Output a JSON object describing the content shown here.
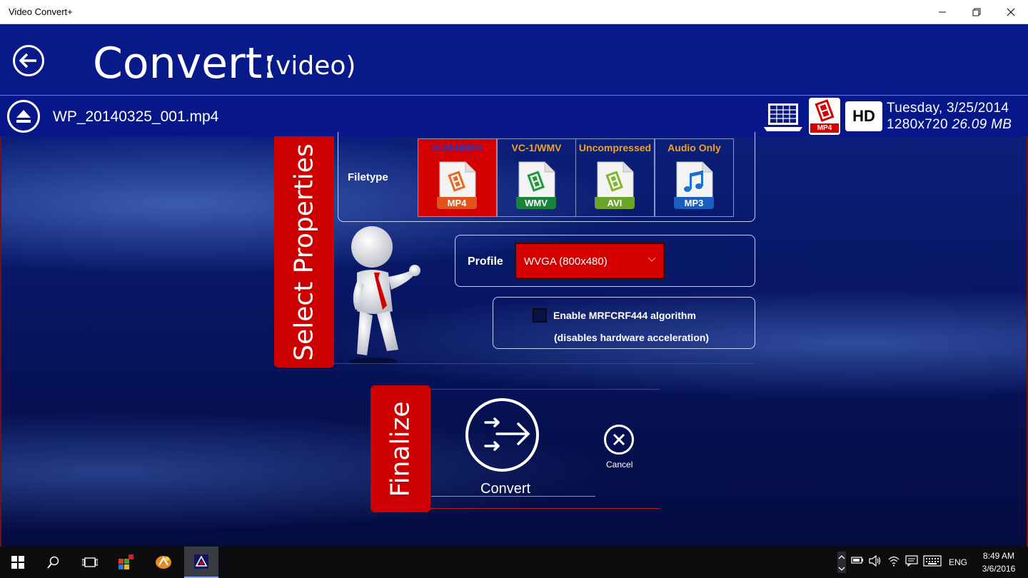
{
  "window": {
    "title": "Video Convert+"
  },
  "header": {
    "title": "Convert:",
    "subtitle": "(video)"
  },
  "file": {
    "name": "WP_20140325_001.mp4",
    "format_badge": "MP4",
    "quality_badge": "HD",
    "date": "Tuesday, 3/25/2014",
    "resolution": "1280x720",
    "size": "26.09 MB"
  },
  "properties": {
    "section_label": "Select Properties",
    "filetype_label": "Filetype",
    "filetypes": [
      {
        "caption": "H.264/MP4",
        "tag": "MP4",
        "selected": true
      },
      {
        "caption": "VC-1/WMV",
        "tag": "WMV",
        "selected": false
      },
      {
        "caption": "Uncompressed",
        "tag": "AVI",
        "selected": false
      },
      {
        "caption": "Audio Only",
        "tag": "MP3",
        "selected": false
      }
    ],
    "profile_label": "Profile",
    "profile_value": "WVGA (800x480)",
    "algorithm_label": "Enable MRFCRF444 algorithm",
    "algorithm_note": "(disables hardware acceleration)",
    "algorithm_checked": false
  },
  "finalize": {
    "section_label": "Finalize",
    "convert_label": "Convert",
    "cancel_label": "Cancel"
  },
  "taskbar": {
    "language": "ENG",
    "time": "8:49 AM",
    "date": "3/6/2016"
  },
  "colors": {
    "accent_red": "#cc0000",
    "header_blue": "#08198a",
    "caption_orange": "#f3a21b"
  }
}
